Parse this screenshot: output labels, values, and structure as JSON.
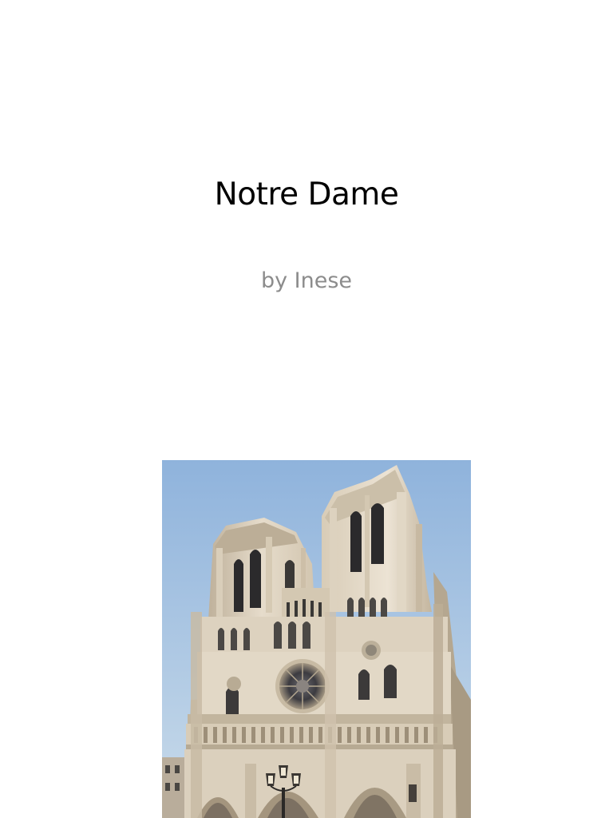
{
  "slide": {
    "title": "Notre Dame",
    "subtitle": "by Inese"
  },
  "photo": {
    "subject": "notre-dame-facade",
    "colors": {
      "sky_top": "#8fb3dc",
      "sky_bottom": "#c7daea",
      "stone_light": "#e6dccb",
      "stone_mid": "#cdbfa8",
      "stone_shadow": "#a89a83",
      "opening_dark": "#2b2a2c"
    }
  }
}
